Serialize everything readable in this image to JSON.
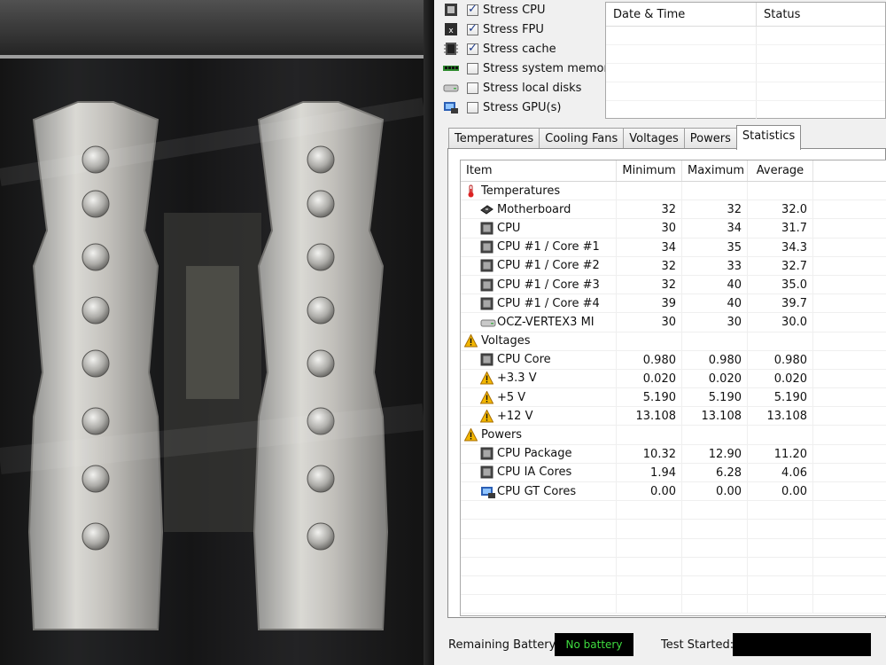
{
  "stress_options": [
    {
      "label": "Stress CPU",
      "checked": true,
      "icon": "cpu-icon"
    },
    {
      "label": "Stress FPU",
      "checked": true,
      "icon": "fpu-icon"
    },
    {
      "label": "Stress cache",
      "checked": true,
      "icon": "cache-icon"
    },
    {
      "label": "Stress system memory",
      "checked": false,
      "icon": "memory-icon"
    },
    {
      "label": "Stress local disks",
      "checked": false,
      "icon": "disk-icon"
    },
    {
      "label": "Stress GPU(s)",
      "checked": false,
      "icon": "gpu-icon"
    }
  ],
  "log": {
    "col_date": "Date & Time",
    "col_status": "Status"
  },
  "tabs": [
    "Temperatures",
    "Cooling Fans",
    "Voltages",
    "Powers",
    "Statistics"
  ],
  "active_tab": "Statistics",
  "stats": {
    "columns": {
      "item": "Item",
      "min": "Minimum",
      "max": "Maximum",
      "avg": "Average"
    },
    "rows": [
      {
        "label": "Temperatures",
        "group": true,
        "icon": "thermometer-icon"
      },
      {
        "label": "Motherboard",
        "min": "32",
        "max": "32",
        "avg": "32.0",
        "icon": "motherboard-icon"
      },
      {
        "label": "CPU",
        "min": "30",
        "max": "34",
        "avg": "31.7",
        "icon": "chip-icon"
      },
      {
        "label": "CPU #1 / Core #1",
        "min": "34",
        "max": "35",
        "avg": "34.3",
        "icon": "chip-icon"
      },
      {
        "label": "CPU #1 / Core #2",
        "min": "32",
        "max": "33",
        "avg": "32.7",
        "icon": "chip-icon"
      },
      {
        "label": "CPU #1 / Core #3",
        "min": "32",
        "max": "40",
        "avg": "35.0",
        "icon": "chip-icon"
      },
      {
        "label": "CPU #1 / Core #4",
        "min": "39",
        "max": "40",
        "avg": "39.7",
        "icon": "chip-icon"
      },
      {
        "label": "OCZ-VERTEX3 MI",
        "min": "30",
        "max": "30",
        "avg": "30.0",
        "icon": "disk-icon"
      },
      {
        "label": "Voltages",
        "group": true,
        "icon": "warning-icon"
      },
      {
        "label": "CPU Core",
        "min": "0.980",
        "max": "0.980",
        "avg": "0.980",
        "icon": "chip-icon"
      },
      {
        "label": "+3.3 V",
        "min": "0.020",
        "max": "0.020",
        "avg": "0.020",
        "icon": "warning-icon"
      },
      {
        "label": "+5 V",
        "min": "5.190",
        "max": "5.190",
        "avg": "5.190",
        "icon": "warning-icon"
      },
      {
        "label": "+12 V",
        "min": "13.108",
        "max": "13.108",
        "avg": "13.108",
        "icon": "warning-icon"
      },
      {
        "label": "Powers",
        "group": true,
        "icon": "warning-icon"
      },
      {
        "label": "CPU Package",
        "min": "10.32",
        "max": "12.90",
        "avg": "11.20",
        "icon": "chip-icon"
      },
      {
        "label": "CPU IA Cores",
        "min": "1.94",
        "max": "6.28",
        "avg": "4.06",
        "icon": "chip-icon"
      },
      {
        "label": "CPU GT Cores",
        "min": "0.00",
        "max": "0.00",
        "avg": "0.00",
        "icon": "gpu-icon"
      }
    ]
  },
  "status_bar": {
    "battery_label": "Remaining Battery:",
    "battery_value": "No battery",
    "started_label": "Test Started:",
    "started_value": ""
  },
  "colors": {
    "battery_text": "#3fdc3f",
    "status_bg": "#000000"
  }
}
